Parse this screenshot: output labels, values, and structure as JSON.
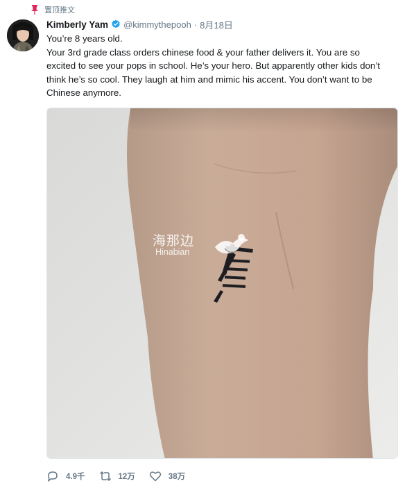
{
  "pinned": {
    "label": "置顶推文",
    "icon": "pin-icon"
  },
  "author": {
    "name": "Kimberly Yam",
    "handle": "@kimmythepooh",
    "separator": "·",
    "date": "8月18日",
    "verified_icon": "verified-badge-icon",
    "verified_color": "#1da1f2"
  },
  "tweet": {
    "lines": [
      "You’re 8 years old.",
      "Your 3rd grade class orders chinese food & your father delivers it. You are so",
      "excited to see your pops in school. He’s your hero. But apparently other kids don’t",
      "think he’s so cool. They laugh at him and mimic his accent. You don’t want to be",
      "Chinese anymore."
    ]
  },
  "media": {
    "watermark_cn": "海那边",
    "watermark_en": "Hinabian",
    "tattoo_glyph": "爸"
  },
  "actions": {
    "reply": {
      "icon": "reply-icon",
      "count": "4.9千"
    },
    "retweet": {
      "icon": "retweet-icon",
      "count": "12万"
    },
    "like": {
      "icon": "heart-icon",
      "count": "38万"
    }
  },
  "colors": {
    "muted": "#657786",
    "text": "#14171a",
    "accent": "#1da1f2",
    "pin": "#e0245e"
  }
}
